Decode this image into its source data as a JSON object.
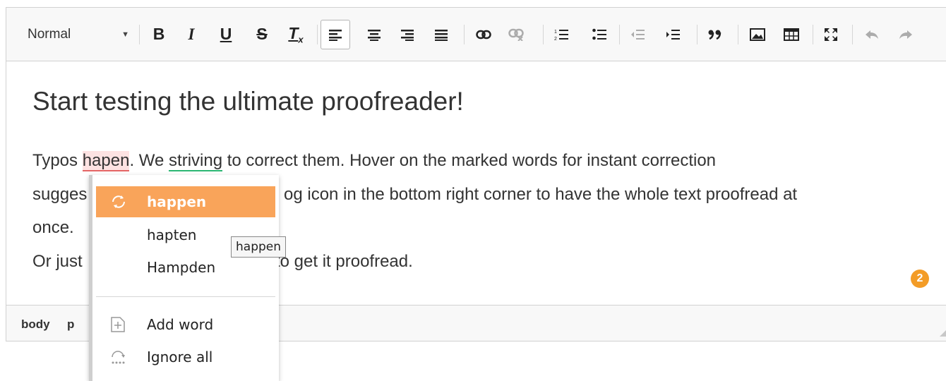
{
  "toolbar": {
    "format_value": "Normal",
    "bold": "B",
    "italic": "I",
    "underline": "U",
    "strike": "S",
    "clear": "T",
    "clear_sub": "x"
  },
  "content": {
    "heading": "Start testing the ultimate proofreader!",
    "p1_a": "Typos ",
    "p1_typo": "hapen",
    "p1_b": ". We ",
    "p1_gram": "striving",
    "p1_c": " to correct them. Hover on the marked words for instant correction",
    "p2_a": "sugges",
    "p2_b": "og icon in the bottom right corner to have the whole text proofread at",
    "p3": "once.",
    "p4_a": "Or just",
    "p4_b": "to get it proofread."
  },
  "badge_count": "2",
  "statusbar": {
    "path1": "body",
    "path2": "p"
  },
  "suggestion_menu": {
    "suggestions": [
      "happen",
      "hapten",
      "Hampden"
    ],
    "actions": [
      "Add word",
      "Ignore all"
    ]
  },
  "tooltip": "happen",
  "colors": {
    "highlight": "#f9a45a",
    "typo": "#e46565",
    "grammar": "#2bb673",
    "badge": "#f39c27"
  }
}
